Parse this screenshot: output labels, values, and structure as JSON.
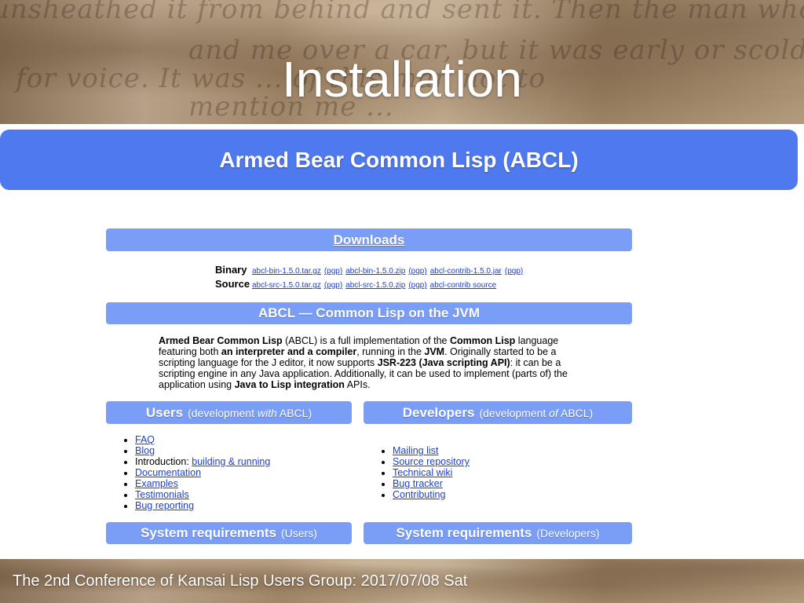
{
  "slide": {
    "title": "Installation",
    "banner": "Armed Bear Common Lisp (ABCL)",
    "footer": "The 2nd Conference of Kansai Lisp Users Group: 2017/07/08 Sat"
  },
  "background_script": [
    "unsheathed it from behind and sent it. Then the man who pulled the car",
    "and me over a car, but it was early or scolded it",
    "for voice. It was ... of this man not to",
    "mention me ..."
  ],
  "downloads": {
    "heading": "Downloads",
    "binary": {
      "label": "Binary",
      "links": [
        "abcl-bin-1.5.0.tar.gz",
        "(pgp)",
        "abcl-bin-1.5.0.zip",
        "(pgp)",
        "abcl-contrib-1.5.0.jar",
        "(pgp)"
      ]
    },
    "source": {
      "label": "Source",
      "links": [
        "abcl-src-1.5.0.tar.gz",
        "(pgp)",
        "abcl-src-1.5.0.zip",
        "(pgp)",
        "abcl-contrib source"
      ]
    }
  },
  "about": {
    "heading": "ABCL — Common Lisp on the JVM",
    "p1": "Armed Bear Common Lisp",
    "p2": " (ABCL) is a full implementation of the ",
    "p3": "Common Lisp",
    "p4": " language featuring both ",
    "p5": "an interpreter and a compiler",
    "p6": ", running in the ",
    "p7": "JVM",
    "p8": ". Originally started to be a scripting language for the J editor, it now supports ",
    "p9": "JSR-223 (Java scripting API)",
    "p10": ": it can be a scripting engine in any Java application. Additionally, it can be used to implement (parts of) the application using ",
    "p11": "Java to Lisp integration",
    "p12": " APIs."
  },
  "users": {
    "heading": "Users",
    "sub_pre": "(development ",
    "sub_em": "with",
    "sub_post": " ABCL)",
    "items": {
      "faq": "FAQ",
      "blog": "Blog",
      "intro_label": "Introduction: ",
      "intro_link": "building & running",
      "documentation": "Documentation",
      "examples": "Examples",
      "testimonials": "Testimonials",
      "bug_reporting": "Bug reporting"
    }
  },
  "developers": {
    "heading": "Developers",
    "sub_pre": "(development ",
    "sub_em": "of",
    "sub_post": " ABCL)",
    "items": {
      "mailing_list": "Mailing list",
      "source_repository": "Source repository",
      "technical_wiki": "Technical wiki",
      "bug_tracker": "Bug tracker",
      "contributing": "Contributing"
    }
  },
  "sysreq": {
    "heading": "System requirements",
    "users_sub": "(Users)",
    "dev_sub": "(Developers)"
  }
}
